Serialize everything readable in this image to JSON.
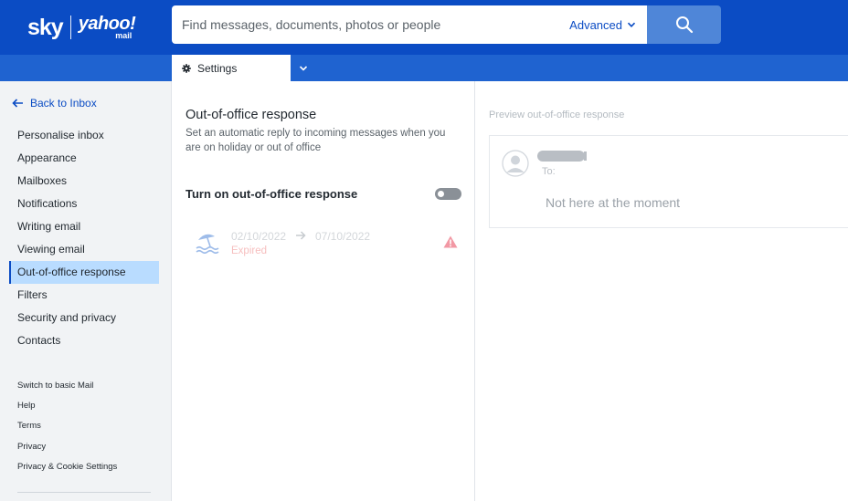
{
  "header": {
    "logo_sky": "sky",
    "logo_yahoo": "yahoo!",
    "logo_mail": "mail",
    "search_placeholder": "Find messages, documents, photos or people",
    "advanced_label": "Advanced",
    "search_icon": "search-icon",
    "accent_color": "#0b4cc4"
  },
  "tabs": {
    "settings_label": "Settings",
    "settings_icon": "gear-icon",
    "more_icon": "chevron-down-icon"
  },
  "sidebar": {
    "back_label": "Back to Inbox",
    "items": [
      {
        "label": "Personalise inbox"
      },
      {
        "label": "Appearance"
      },
      {
        "label": "Mailboxes"
      },
      {
        "label": "Notifications"
      },
      {
        "label": "Writing email"
      },
      {
        "label": "Viewing email"
      },
      {
        "label": "Out-of-office response",
        "active": true
      },
      {
        "label": "Filters"
      },
      {
        "label": "Security and privacy"
      },
      {
        "label": "Contacts"
      }
    ],
    "links": [
      {
        "label": "Switch to basic Mail"
      },
      {
        "label": "Help"
      },
      {
        "label": "Terms"
      },
      {
        "label": "Privacy"
      },
      {
        "label": "Privacy & Cookie Settings"
      }
    ]
  },
  "settings": {
    "title": "Out-of-office response",
    "description": "Set an automatic reply to incoming messages when you are on holiday or out of office",
    "toggle_label": "Turn on out-of-office response",
    "toggle_on": false,
    "schedule": {
      "start_date": "02/10/2022",
      "end_date": "07/10/2022",
      "status": "Expired",
      "icon": "beach-umbrella-icon",
      "warning_icon": "warning-icon"
    }
  },
  "preview": {
    "label": "Preview out-of-office response",
    "to_label": "To:",
    "message": "Not here at the moment"
  }
}
